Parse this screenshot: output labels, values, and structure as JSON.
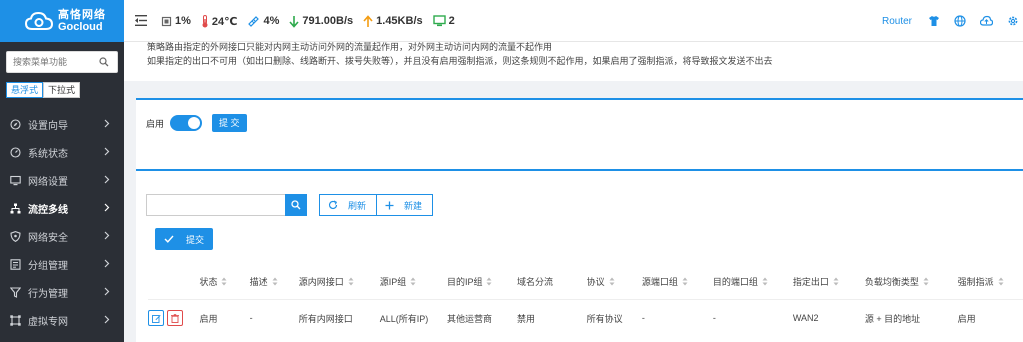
{
  "brand": {
    "cn": "高恪网络",
    "en": "Gocloud",
    "color": "#1e90e6"
  },
  "status_bar": {
    "cpu": "1%",
    "temperature": "24℃",
    "memory": "4%",
    "download": "791.00B/s",
    "upload": "1.45KB/s",
    "devices": "2"
  },
  "header_right": {
    "router_label": "Router",
    "icons": [
      "shirt-icon",
      "globe-icon",
      "cloud-upload-icon",
      "settings-icon"
    ]
  },
  "sidebar": {
    "search_placeholder": "搜索菜单功能",
    "modes": [
      "悬浮式",
      "下拉式"
    ],
    "items": [
      {
        "label": "设置向导",
        "icon": "compass-icon"
      },
      {
        "label": "系统状态",
        "icon": "dashboard-icon"
      },
      {
        "label": "网络设置",
        "icon": "monitor-icon"
      },
      {
        "label": "流控多线",
        "icon": "sitemap-icon",
        "active": true
      },
      {
        "label": "网络安全",
        "icon": "shield-icon"
      },
      {
        "label": "分组管理",
        "icon": "list-icon"
      },
      {
        "label": "行为管理",
        "icon": "filter-icon"
      },
      {
        "label": "虚拟专网",
        "icon": "vpn-icon"
      }
    ]
  },
  "notice": {
    "line1": "策略路由指定的外网接口只能对内网主动访问外网的流量起作用，对外网主动访问内网的流量不起作用",
    "line2": "如果指定的出口不可用（如出口删除、线路断开、拨号失败等），并且没有启用强制指派，则这条规则不起作用，如果启用了强制指派，将导致报文发送不出去"
  },
  "enable_panel": {
    "label": "启用",
    "enabled": true,
    "submit_label": "提 交"
  },
  "toolbar": {
    "search_value": "",
    "refresh_label": "刷新",
    "new_label": "新建",
    "submit_label": "提交"
  },
  "table": {
    "columns": [
      "状态",
      "描述",
      "源内网接口",
      "源IP组",
      "目的IP组",
      "域名分流",
      "协议",
      "源端口组",
      "目的端口组",
      "指定出口",
      "负载均衡类型",
      "强制指派"
    ],
    "sortable": [
      true,
      true,
      true,
      true,
      true,
      false,
      true,
      true,
      true,
      true,
      true,
      true
    ],
    "rows": [
      [
        "启用",
        "-",
        "所有内网接口",
        "ALL(所有IP)",
        "其他运营商",
        "禁用",
        "所有协议",
        "-",
        "-",
        "WAN2",
        "源 + 目的地址",
        "启用"
      ]
    ]
  }
}
